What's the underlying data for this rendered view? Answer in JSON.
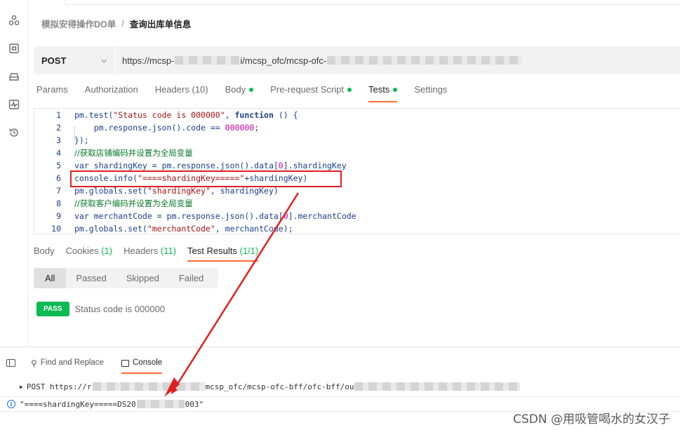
{
  "breadcrumb": {
    "parent": "模拟安得操作DO单",
    "separator": "/",
    "current": "查询出库单信息"
  },
  "request": {
    "method": "POST",
    "url_segments": [
      "https://mcsp-",
      "i/mcsp_ofc/mcsp-ofc-"
    ]
  },
  "request_tabs": [
    {
      "label": "Params",
      "count": "",
      "dot": false
    },
    {
      "label": "Authorization",
      "count": "",
      "dot": false
    },
    {
      "label": "Headers",
      "count": "(10)",
      "dot": false
    },
    {
      "label": "Body",
      "count": "",
      "dot": true
    },
    {
      "label": "Pre-request Script",
      "count": "",
      "dot": true
    },
    {
      "label": "Tests",
      "count": "",
      "dot": true,
      "active": true
    },
    {
      "label": "Settings",
      "count": "",
      "dot": false
    }
  ],
  "code_lines": [
    {
      "n": "1",
      "segments": [
        [
          "t",
          "pm.test("
        ],
        [
          "s",
          "\"Status code is 000000\""
        ],
        [
          "t",
          ", "
        ],
        [
          "k",
          "function"
        ],
        [
          "t",
          " () {"
        ]
      ]
    },
    {
      "n": "2",
      "segments": [
        [
          "t",
          "    pm.response.json().code == "
        ],
        [
          "n",
          "000000"
        ],
        [
          "t",
          ";"
        ]
      ]
    },
    {
      "n": "3",
      "segments": [
        [
          "t",
          "});"
        ]
      ]
    },
    {
      "n": "4",
      "segments": [
        [
          "c",
          "//获取店铺编码并设置为全局变量"
        ]
      ]
    },
    {
      "n": "5",
      "segments": [
        [
          "t",
          "var shardingKey = pm.response.json().data["
        ],
        [
          "n",
          "0"
        ],
        [
          "t",
          "].shardingKey"
        ]
      ]
    },
    {
      "n": "6",
      "segments": [
        [
          "t",
          "console.info("
        ],
        [
          "s",
          "\"====shardingKey=====\""
        ],
        [
          "t",
          "+shardingKey)"
        ]
      ]
    },
    {
      "n": "7",
      "segments": [
        [
          "t",
          "pm.globals.set("
        ],
        [
          "s",
          "\"shardingKey\""
        ],
        [
          "t",
          ", shardingKey)"
        ]
      ]
    },
    {
      "n": "8",
      "segments": [
        [
          "c",
          "//获取客户编码并设置为全局变量"
        ]
      ]
    },
    {
      "n": "9",
      "segments": [
        [
          "t",
          "var merchantCode = pm.response.json().data["
        ],
        [
          "n",
          "0"
        ],
        [
          "t",
          "].merchantCode"
        ]
      ]
    },
    {
      "n": "10",
      "segments": [
        [
          "t",
          "pm.globals.set("
        ],
        [
          "s",
          "\"merchantCode\""
        ],
        [
          "t",
          ", merchantCode);"
        ]
      ]
    }
  ],
  "response_tabs": [
    {
      "label": "Body",
      "count": ""
    },
    {
      "label": "Cookies",
      "count": "(1)"
    },
    {
      "label": "Headers",
      "count": "(11)"
    },
    {
      "label": "Test Results",
      "count": "(1/1)",
      "active": true
    }
  ],
  "filters": [
    "All",
    "Passed",
    "Skipped",
    "Failed"
  ],
  "test_result": {
    "badge": "PASS",
    "text": "Status code is 000000"
  },
  "bottom_tabs": {
    "find_replace": "Find and Replace",
    "console": "Console"
  },
  "console": {
    "line1_prefix": "POST https://r",
    "line1_mid": "mcsp_ofc/mcsp-ofc-bff/ofc-bff/ou",
    "line2_prefix": "\"====shardingKey=====DS20",
    "line2_suffix": "003\""
  },
  "watermark": "CSDN @用吸管喝水的女汉子",
  "colors": {
    "accent": "#ff6c37",
    "success": "#0cbb52",
    "annotation": "#e02020"
  },
  "icons": [
    "apis-icon",
    "environments-icon",
    "mock-servers-icon",
    "monitors-icon",
    "history-icon",
    "toggle-sidebar-icon",
    "search-icon",
    "console-icon",
    "info-icon"
  ]
}
